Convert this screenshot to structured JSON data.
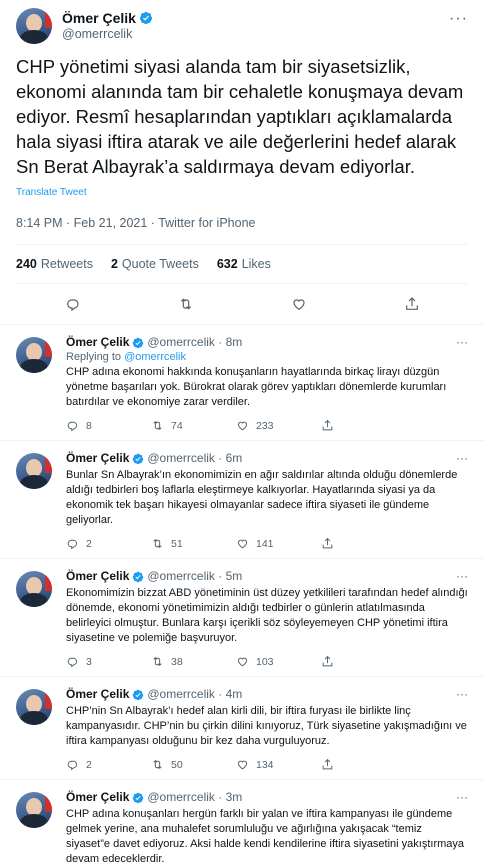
{
  "main_tweet": {
    "name": "Ömer Çelik",
    "handle": "@omerrcelik",
    "text": "CHP yönetimi siyasi alanda tam bir siyasetsizlik, ekonomi alanında tam bir cehaletle konuşmaya devam ediyor. Resmî hesaplarından yaptıkları açıklamalarda hala siyasi iftira atarak ve aile değerlerini hedef alarak Sn Berat Albayrak’a saldırmaya devam ediyorlar.",
    "translate_label": "Translate Tweet",
    "meta": "8:14 PM · Feb 21, 2021 · Twitter for iPhone",
    "retweets_count": "240",
    "retweets_label": "Retweets",
    "quotes_count": "2",
    "quotes_label": "Quote Tweets",
    "likes_count": "632",
    "likes_label": "Likes"
  },
  "replies": [
    {
      "name": "Ömer Çelik",
      "handle": "@omerrcelik · 8m",
      "replying_prefix": "Replying to ",
      "replying_to": "@omerrcelik",
      "text": "CHP adına ekonomi hakkında konuşanların hayatlarında birkaç lirayı düzgün yönetme başarıları yok. Bürokrat olarak görev yaptıkları dönemlerde kurumları batırdılar ve ekonomiye zarar verdiler.",
      "replies": "8",
      "retweets": "74",
      "likes": "233"
    },
    {
      "name": "Ömer Çelik",
      "handle": "@omerrcelik · 6m",
      "text": "Bunlar Sn Albayrak’ın ekonomimizin en ağır saldırılar altında olduğu dönemlerde aldığı tedbirleri boş laflarla eleştirmeye kalkıyorlar. Hayatlarında siyasi ya da ekonomik tek başarı hikayesi olmayanlar sadece iftira siyaseti ile gündeme geliyorlar.",
      "replies": "2",
      "retweets": "51",
      "likes": "141"
    },
    {
      "name": "Ömer Çelik",
      "handle": "@omerrcelik · 5m",
      "text": "Ekonomimizin bizzat ABD yönetiminin üst düzey yetkilileri tarafından hedef alındığı dönemde, ekonomi yönetimimizin aldığı tedbirler o günlerin atlatılmasında belirleyici olmuştur. Bunlara karşı içerikli söz söyleyemeyen CHP yönetimi iftira siyasetine ve polemiğe başvuruyor.",
      "replies": "3",
      "retweets": "38",
      "likes": "103"
    },
    {
      "name": "Ömer Çelik",
      "handle": "@omerrcelik · 4m",
      "text": "CHP’nin Sn Albayrak’ı hedef alan kirli dili, bir iftira furyası ile birlikte linç kampanyasıdır. CHP’nin bu çirkin dilini kınıyoruz, Türk siyasetine yakışmadığını ve iftira kampanyası olduğunu bir kez daha vurguluyoruz.",
      "replies": "2",
      "retweets": "50",
      "likes": "134"
    },
    {
      "name": "Ömer Çelik",
      "handle": "@omerrcelik · 3m",
      "text": "CHP adına konuşanları hergün farklı bir yalan ve iftira kampanyası ile gündeme gelmek yerine, ana muhalefet sorumluluğu ve ağırlığına yakışacak “temiz siyaset”e davet ediyoruz. Aksi halde kendi kendilerine iftira siyasetini yakıştırmaya devam edeceklerdir.",
      "replies": "",
      "retweets": "",
      "likes": ""
    }
  ],
  "colors": {
    "accent": "#1d9bf0",
    "muted": "#536471",
    "text": "#0f1419",
    "border": "#eff3f4"
  },
  "icons": [
    "verified-badge-icon",
    "more-icon",
    "reply-icon",
    "retweet-icon",
    "like-icon",
    "share-icon"
  ]
}
